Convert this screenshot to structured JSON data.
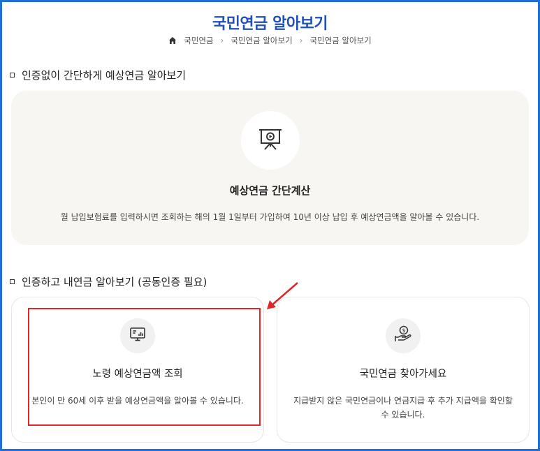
{
  "page": {
    "title": "국민연금 알아보기",
    "breadcrumb": [
      "국민연금",
      "국민연금 알아보기",
      "국민연금 알아보기"
    ]
  },
  "section1": {
    "heading": "인증없이 간단하게 예상연금 알아보기",
    "card": {
      "icon": "presentation-board-icon",
      "title": "예상연금 간단계산",
      "description": "월 납입보험료를 입력하시면 조회하는 해의 1월 1일부터 가입하여 10년 이상 납입 후 예상연금액을 알아볼 수 있습니다."
    }
  },
  "section2": {
    "heading": "인증하고 내연금 알아보기 (공동인증 필요)",
    "cards": [
      {
        "icon": "monitor-chart-icon",
        "title": "노령 예상연금액 조회",
        "description": "본인이 만 60세 이후 받을 예상연금액을 알아볼 수 있습니다."
      },
      {
        "icon": "hand-coin-icon",
        "title": "국민연금 찾아가세요",
        "description_line1": "지급받지 않은 국민연금이나 연금지급 후 추가 지급액을 확인할",
        "description_line2": "수 있습니다."
      }
    ]
  },
  "colors": {
    "title": "#2150b9",
    "frame_border": "#1f6fd6",
    "highlight": "#e0252b",
    "panel_bg": "#f8f6f3"
  }
}
